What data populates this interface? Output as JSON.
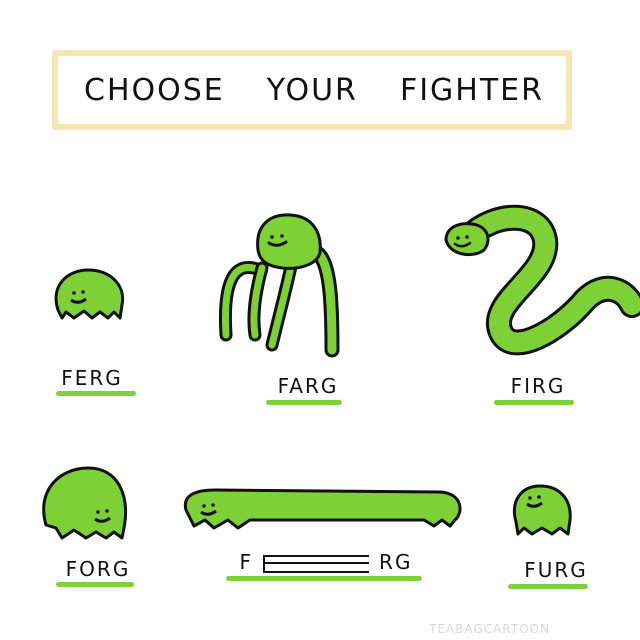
{
  "title": {
    "words": [
      "CHOOSE",
      "YOUR",
      "FIGHTER"
    ]
  },
  "fighters": [
    {
      "name": "FERG"
    },
    {
      "name": "FARG"
    },
    {
      "name": "FIRG"
    },
    {
      "name": "FORG"
    },
    {
      "name_prefix": "F",
      "name_suffix": "RG"
    },
    {
      "name": "FURG"
    }
  ],
  "credit": "TEABAGCARTOON",
  "colors": {
    "creature_fill": "#7dd136",
    "underline": "#7fd13a",
    "title_border": "#f6e6b4",
    "outline": "#111111"
  }
}
